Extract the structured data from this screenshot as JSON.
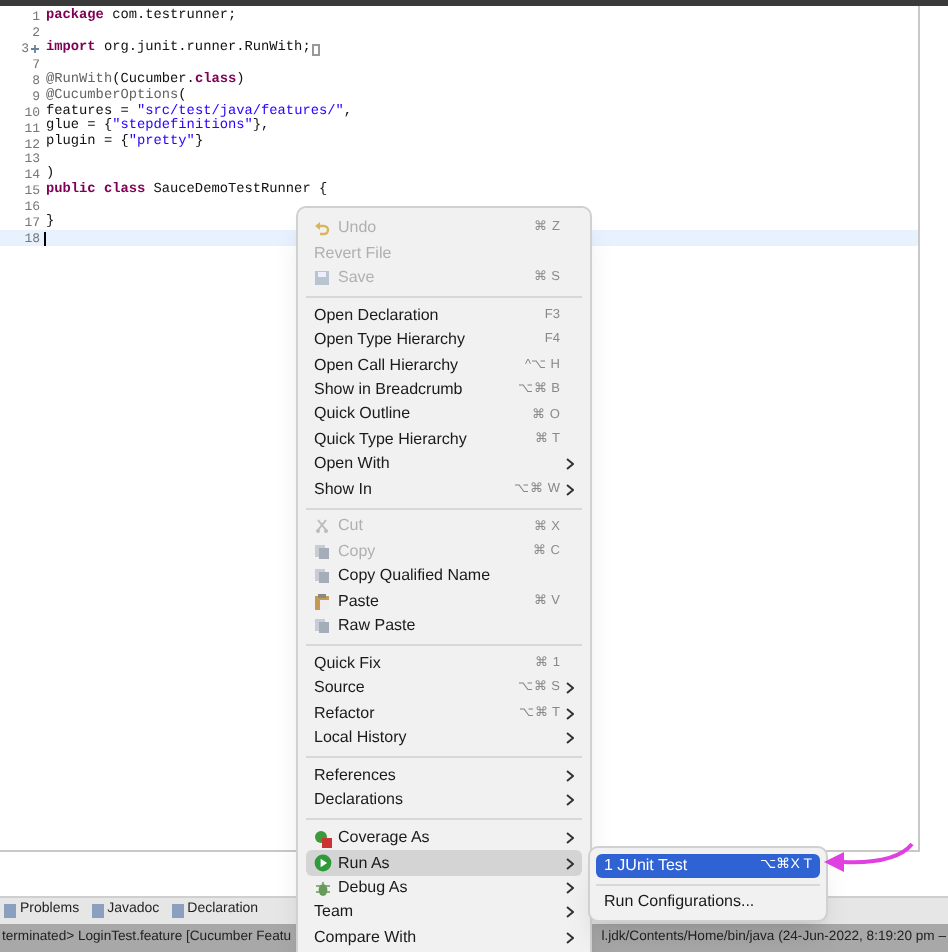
{
  "editor": {
    "lines": [
      {
        "number": "1",
        "tokens": [
          {
            "text": "package",
            "kind": "keyword"
          },
          {
            "text": " com.testrunner;",
            "kind": "plain"
          }
        ]
      },
      {
        "number": "2"
      },
      {
        "number": "3",
        "folded": true,
        "tokens": [
          {
            "text": "import",
            "kind": "keyword"
          },
          {
            "text": " org.junit.runner.RunWith;",
            "kind": "plain"
          }
        ]
      },
      {
        "number": "7"
      },
      {
        "number": "8",
        "tokens": [
          {
            "text": "@RunWith",
            "kind": "annotation"
          },
          {
            "text": "(Cucumber.",
            "kind": "plain"
          },
          {
            "text": "class",
            "kind": "keyword"
          },
          {
            "text": ")",
            "kind": "plain"
          }
        ]
      },
      {
        "number": "9",
        "tokens": [
          {
            "text": "@CucumberOptions",
            "kind": "annotation"
          },
          {
            "text": "(",
            "kind": "plain"
          }
        ]
      },
      {
        "number": "10",
        "tokens": [
          {
            "text": "features = ",
            "kind": "plain"
          },
          {
            "text": "\"src/test/java/features/\"",
            "kind": "string"
          },
          {
            "text": ",",
            "kind": "plain"
          }
        ]
      },
      {
        "number": "11",
        "tokens": [
          {
            "text": "glue = {",
            "kind": "plain"
          },
          {
            "text": "\"stepdefinitions\"",
            "kind": "string"
          },
          {
            "text": "},",
            "kind": "plain"
          }
        ]
      },
      {
        "number": "12",
        "tokens": [
          {
            "text": "plugin = {",
            "kind": "plain"
          },
          {
            "text": "\"pretty\"",
            "kind": "string"
          },
          {
            "text": "}",
            "kind": "plain"
          }
        ]
      },
      {
        "number": "13"
      },
      {
        "number": "14",
        "tokens": [
          {
            "text": ")",
            "kind": "plain"
          }
        ]
      },
      {
        "number": "15",
        "tokens": [
          {
            "text": "public class",
            "kind": "keyword"
          },
          {
            "text": " SauceDemoTestRunner {",
            "kind": "plain"
          }
        ]
      },
      {
        "number": "16"
      },
      {
        "number": "17",
        "tokens": [
          {
            "text": "}",
            "kind": "plain"
          }
        ]
      },
      {
        "number": "18",
        "current": true
      }
    ]
  },
  "context_menu": {
    "items": [
      {
        "kind": "item",
        "label": "Undo",
        "shortcut": "⌘ Z",
        "disabled": true,
        "selected": false
      },
      {
        "kind": "item",
        "label": "Revert File",
        "disabled": true,
        "selected": false
      },
      {
        "kind": "item",
        "label": "Save",
        "shortcut": "⌘ S",
        "disabled": true,
        "selected": false
      },
      {
        "kind": "separator"
      },
      {
        "kind": "item",
        "label": "Open Declaration",
        "shortcut": "F3",
        "disabled": false,
        "selected": false
      },
      {
        "kind": "item",
        "label": "Open Type Hierarchy",
        "shortcut": "F4",
        "disabled": false,
        "selected": false
      },
      {
        "kind": "item",
        "label": "Open Call Hierarchy",
        "shortcut": "^⌥ H",
        "disabled": false,
        "selected": false
      },
      {
        "kind": "item",
        "label": "Show in Breadcrumb",
        "shortcut": "⌥⌘ B",
        "disabled": false,
        "selected": false
      },
      {
        "kind": "item",
        "label": "Quick Outline",
        "shortcut": "⌘ O",
        "disabled": false,
        "selected": false
      },
      {
        "kind": "item",
        "label": "Quick Type Hierarchy",
        "shortcut": "⌘ T",
        "disabled": false,
        "selected": false
      },
      {
        "kind": "item",
        "label": "Open With",
        "submenu": true,
        "disabled": false,
        "selected": false
      },
      {
        "kind": "item",
        "label": "Show In",
        "shortcut": "⌥⌘ W",
        "submenu": true,
        "disabled": false,
        "selected": false
      },
      {
        "kind": "separator"
      },
      {
        "kind": "item",
        "label": "Cut",
        "shortcut": "⌘ X",
        "disabled": true,
        "selected": false
      },
      {
        "kind": "item",
        "label": "Copy",
        "shortcut": "⌘ C",
        "disabled": true,
        "selected": false
      },
      {
        "kind": "item",
        "label": "Copy Qualified Name",
        "disabled": false,
        "selected": false
      },
      {
        "kind": "item",
        "label": "Paste",
        "shortcut": "⌘ V",
        "disabled": false,
        "selected": false
      },
      {
        "kind": "item",
        "label": "Raw Paste",
        "disabled": false,
        "selected": false
      },
      {
        "kind": "separator"
      },
      {
        "kind": "item",
        "label": "Quick Fix",
        "shortcut": "⌘ 1",
        "disabled": false,
        "selected": false
      },
      {
        "kind": "item",
        "label": "Source",
        "shortcut": "⌥⌘ S",
        "submenu": true,
        "disabled": false,
        "selected": false
      },
      {
        "kind": "item",
        "label": "Refactor",
        "shortcut": "⌥⌘ T",
        "submenu": true,
        "disabled": false,
        "selected": false
      },
      {
        "kind": "item",
        "label": "Local History",
        "submenu": true,
        "disabled": false,
        "selected": false
      },
      {
        "kind": "separator"
      },
      {
        "kind": "item",
        "label": "References",
        "submenu": true,
        "disabled": false,
        "selected": false
      },
      {
        "kind": "item",
        "label": "Declarations",
        "submenu": true,
        "disabled": false,
        "selected": false
      },
      {
        "kind": "separator"
      },
      {
        "kind": "item",
        "label": "Coverage As",
        "submenu": true,
        "disabled": false,
        "selected": false
      },
      {
        "kind": "item",
        "label": "Run As",
        "submenu": true,
        "disabled": false,
        "selected": true
      },
      {
        "kind": "item",
        "label": "Debug As",
        "submenu": true,
        "disabled": false,
        "selected": false
      },
      {
        "kind": "item",
        "label": "Team",
        "submenu": true,
        "disabled": false,
        "selected": false
      },
      {
        "kind": "item",
        "label": "Compare With",
        "submenu": true,
        "disabled": false,
        "selected": false
      }
    ]
  },
  "submenu": {
    "items": [
      {
        "kind": "item",
        "label": "1 JUnit Test",
        "shortcut": "⌥⌘X T",
        "selected": true
      },
      {
        "kind": "separator"
      },
      {
        "kind": "item",
        "label": "Run Configurations...",
        "selected": false
      }
    ]
  },
  "bottom_tabs": [
    "Problems",
    "Javadoc",
    "Declaration"
  ],
  "console": {
    "left": "terminated> LoginTest.feature [Cucumber Featu",
    "right": "l.jdk/Contents/Home/bin/java  (24-Jun-2022, 8:19:20 pm –"
  }
}
